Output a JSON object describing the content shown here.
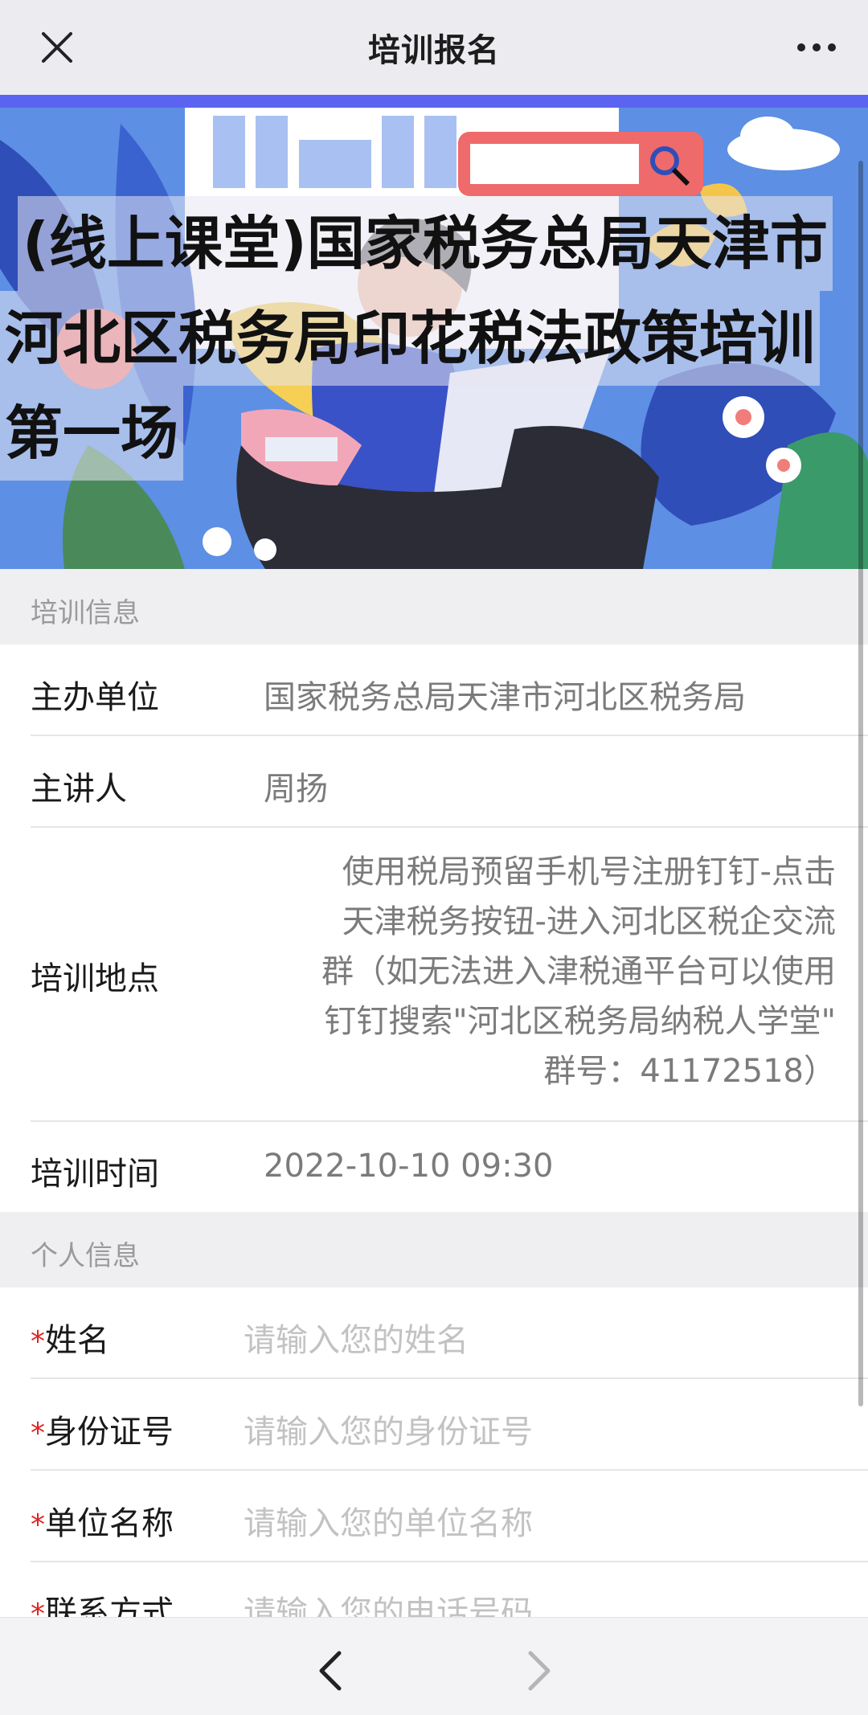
{
  "header": {
    "title": "培训报名",
    "close_icon": "close-icon",
    "more_icon": "more-icon"
  },
  "banner": {
    "title_lines": [
      "(线上课堂)国家税务总局天津市",
      "河北区税务局印花税法政策培训",
      "第一场"
    ]
  },
  "training_info": {
    "section_title": "培训信息",
    "rows": [
      {
        "label": "主办单位",
        "value": "国家税务总局天津市河北区税务局"
      },
      {
        "label": "主讲人",
        "value": "周扬"
      },
      {
        "label": "培训地点",
        "value": "使用税局预留手机号注册钉钉-点击\n天津税务按钮-进入河北区税企交流\n群（如无法进入津税通平台可以使用\n钉钉搜索\"河北区税务局纳税人学堂\"\n群号：41172518）"
      },
      {
        "label": "培训时间",
        "value": "2022-10-10 09:30"
      }
    ]
  },
  "personal_info": {
    "section_title": "个人信息",
    "required_mark": "*",
    "fields": [
      {
        "label": "姓名",
        "placeholder": "请输入您的姓名"
      },
      {
        "label": "身份证号",
        "placeholder": "请输入您的身份证号"
      },
      {
        "label": "单位名称",
        "placeholder": "请输入您的单位名称"
      },
      {
        "label": "联系方式",
        "placeholder": "请输入您的电话号码"
      }
    ]
  },
  "nav": {
    "back_icon": "chevron-left-icon",
    "forward_icon": "chevron-right-icon"
  },
  "colors": {
    "accent": "#5b64f0",
    "required": "#e02424",
    "banner_bg": "#5d8fe4"
  }
}
